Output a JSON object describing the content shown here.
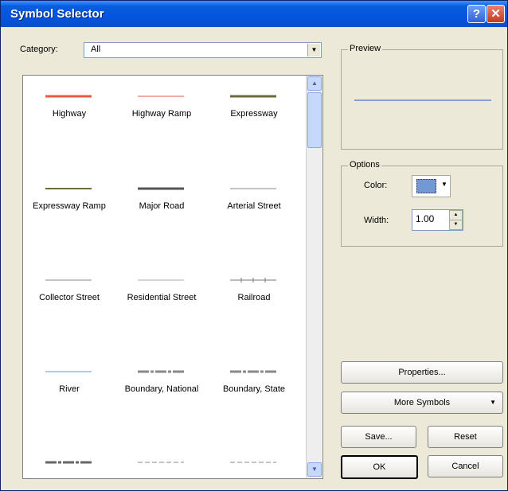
{
  "window": {
    "title": "Symbol Selector",
    "help_label": "?",
    "close_label": "✕"
  },
  "category": {
    "label": "Category:",
    "value": "All"
  },
  "symbols": [
    {
      "name": "Highway",
      "color": "#ea5a3a",
      "style": "thick"
    },
    {
      "name": "Highway Ramp",
      "color": "#ea5a3a",
      "style": "thin"
    },
    {
      "name": "Expressway",
      "color": "#6e6a3a",
      "style": "thick"
    },
    {
      "name": "Expressway Ramp",
      "color": "#6e6a3a",
      "style": "medium"
    },
    {
      "name": "Major Road",
      "color": "#555555",
      "style": "thick"
    },
    {
      "name": "Arterial Street",
      "color": "#888888",
      "style": "thin"
    },
    {
      "name": "Collector Street",
      "color": "#888888",
      "style": "thin"
    },
    {
      "name": "Residential Street",
      "color": "#aaaaaa",
      "style": "thin"
    },
    {
      "name": "Railroad",
      "color": "#777777",
      "style": "rail"
    },
    {
      "name": "River",
      "color": "#5c9ee0",
      "style": "thin"
    },
    {
      "name": "Boundary, National",
      "color": "#888888",
      "style": "boundary"
    },
    {
      "name": "Boundary, State",
      "color": "#888888",
      "style": "boundary"
    },
    {
      "name": "",
      "color": "#666666",
      "style": "boundary"
    },
    {
      "name": "",
      "color": "#888888",
      "style": "dashed"
    },
    {
      "name": "",
      "color": "#888888",
      "style": "dashed"
    }
  ],
  "preview": {
    "label": "Preview",
    "line_color": "#6188d2"
  },
  "options": {
    "label": "Options",
    "color_label": "Color:",
    "color_value": "#7299d3",
    "width_label": "Width:",
    "width_value": "1.00"
  },
  "buttons": {
    "properties": "Properties...",
    "more_symbols": "More Symbols",
    "save": "Save...",
    "reset": "Reset",
    "ok": "OK",
    "cancel": "Cancel"
  }
}
